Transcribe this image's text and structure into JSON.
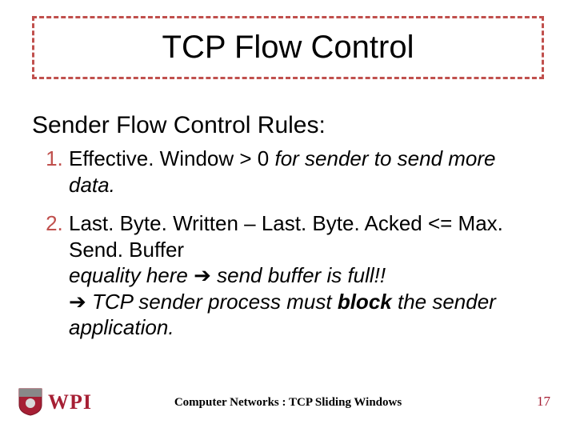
{
  "title": "TCP Flow Control",
  "subtitle": "Sender Flow Control Rules:",
  "item1_cond": "Effective. Window > 0",
  "item1_rest": "  for sender to send more data.",
  "item2_line1": "Last. Byte. Written – Last. Byte. Acked <= Max. Send. Buffer",
  "item2_line2a": "equality here ",
  "item2_arrow1": "➔",
  "item2_line2b": " send buffer is full!!",
  "item2_arrow2": "➔",
  "item2_line3a": " TCP sender process must ",
  "item2_block": "block",
  "item2_line3b": " the sender application.",
  "footer_center": "Computer Networks : TCP Sliding Windows",
  "page_number": "17",
  "logo_text": "WPI"
}
